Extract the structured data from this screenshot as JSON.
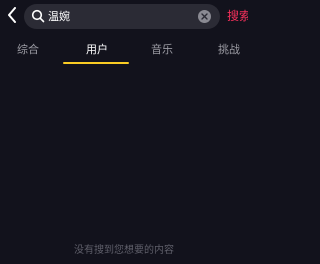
{
  "search": {
    "query": "温婉",
    "action_label": "搜索"
  },
  "tabs": [
    {
      "label": "综合",
      "active": false
    },
    {
      "label": "用户",
      "active": true
    },
    {
      "label": "音乐",
      "active": false
    },
    {
      "label": "挑战",
      "active": false
    }
  ],
  "results": {
    "empty_message": "没有搜到您想要的内容"
  },
  "icons": {
    "back": "chevron-left-icon",
    "search": "search-icon",
    "clear": "close-icon"
  },
  "colors": {
    "background": "#12121c",
    "search_box": "#2b2b35",
    "accent_red": "#f2305a",
    "tab_indicator": "#facc24",
    "tab_inactive": "#9b9ba3",
    "empty_text": "#5e5e69"
  }
}
